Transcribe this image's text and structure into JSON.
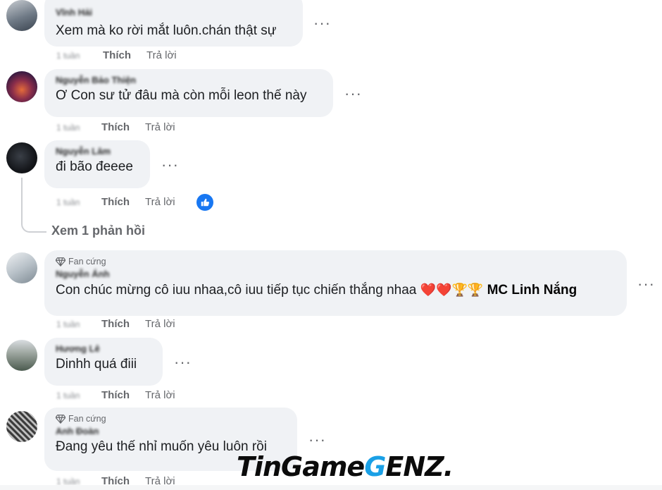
{
  "comments": [
    {
      "author": "Vĩnh Hải",
      "text": "Xem mà ko rời mắt luôn.chán thật sự",
      "time": "1 tuần",
      "like_label": "Thích",
      "reply_label": "Trả lời"
    },
    {
      "author": "Nguyễn Bảo Thiện",
      "text": "Ơ Con sư tử đâu mà còn mỗi leon thế này",
      "time": "1 tuần",
      "like_label": "Thích",
      "reply_label": "Trả lời"
    },
    {
      "author": "Nguyễn Lâm",
      "text": "đi bão đeeee",
      "time": "1 tuần",
      "like_label": "Thích",
      "reply_label": "Trả lời",
      "view_replies": "Xem 1 phản hồi"
    },
    {
      "badge": "Fan cứng",
      "author": "Nguyễn Ánh",
      "text": "Con chúc mừng cô iuu nhaa,cô iuu tiếp tục chiến thắng nhaa",
      "emojis": "❤️❤️🏆🏆",
      "mention": "MC Linh Nắng",
      "time": "1 tuần",
      "like_label": "Thích",
      "reply_label": "Trả lời"
    },
    {
      "author": "Hương Lê",
      "text": "Dinhh quá điii",
      "time": "1 tuần",
      "like_label": "Thích",
      "reply_label": "Trả lời"
    },
    {
      "badge": "Fan cứng",
      "author": "Anh Đoàn",
      "text": "Đang yêu thế nhỉ muốn yêu luôn rồi",
      "time": "1 tuần",
      "like_label": "Thích",
      "reply_label": "Trả lời"
    }
  ],
  "more_dots": "···",
  "watermark": {
    "part1": "TinGame",
    "part2": "G",
    "part3": "ENZ."
  },
  "colors": {
    "bubble": "#f0f2f5",
    "meta_text": "#65676b",
    "like_blue": "#1877f2",
    "watermark_accent": "#1aa0e6"
  },
  "icons": [
    "diamond-icon",
    "like-reaction-icon",
    "more-options-icon"
  ]
}
